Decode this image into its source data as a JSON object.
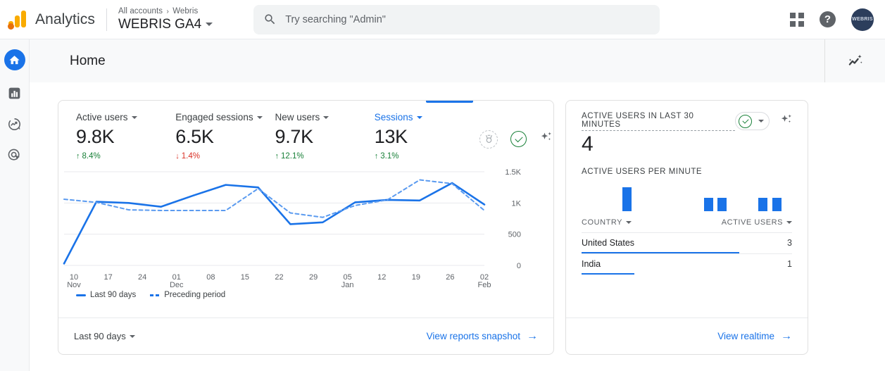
{
  "topbar": {
    "brand": "Analytics",
    "breadcrumb_all": "All accounts",
    "breadcrumb_sep": "›",
    "breadcrumb_account": "Webris",
    "property": "WEBRIS GA4",
    "search_placeholder": "Try searching \"Admin\"",
    "search_value": "",
    "help_glyph": "?",
    "avatar_text": "WEBRIS"
  },
  "sidebar": {
    "items": [
      {
        "name": "home",
        "label": "Home",
        "active": true
      },
      {
        "name": "reports",
        "label": "Reports",
        "active": false
      },
      {
        "name": "explore",
        "label": "Explore",
        "active": false
      },
      {
        "name": "advertising",
        "label": "Advertising",
        "active": false
      }
    ]
  },
  "page": {
    "title": "Home",
    "insights_icon": "insights-sparkle-icon"
  },
  "overview": {
    "metrics": [
      {
        "label": "Active users",
        "value": "9.8K",
        "delta": "8.4%",
        "direction": "up",
        "selected": false
      },
      {
        "label": "Engaged sessions",
        "value": "6.5K",
        "delta": "1.4%",
        "direction": "down",
        "selected": false
      },
      {
        "label": "New users",
        "value": "9.7K",
        "delta": "12.1%",
        "direction": "up",
        "selected": false
      },
      {
        "label": "Sessions",
        "value": "13K",
        "delta": "3.1%",
        "direction": "up",
        "selected": true
      }
    ],
    "arrow_up": "↑",
    "arrow_down": "↓",
    "legend": [
      {
        "label": "Last 90 days",
        "style": "solid"
      },
      {
        "label": "Preceding period",
        "style": "dashed"
      }
    ],
    "date_range": "Last 90 days",
    "footer_link": "View reports snapshot",
    "footer_arrow": "→",
    "accent_color": "#1a73e8",
    "up_color": "#188038",
    "down_color": "#d93025"
  },
  "chart_data": {
    "type": "line",
    "title": "Sessions",
    "xlabel": "",
    "ylabel": "",
    "ylim": [
      0,
      1500
    ],
    "yticks": [
      0,
      500,
      1000,
      1500
    ],
    "ytick_labels": [
      "0",
      "500",
      "1K",
      "1.5K"
    ],
    "grid": true,
    "legend_position": "bottom-left",
    "x": [
      "10 Nov",
      "17",
      "24",
      "01 Dec",
      "08",
      "15",
      "22",
      "29",
      "05 Jan",
      "12",
      "19",
      "26",
      "02 Feb"
    ],
    "xtick_labels": [
      {
        "day": "10",
        "month": "Nov"
      },
      {
        "day": "17",
        "month": ""
      },
      {
        "day": "24",
        "month": ""
      },
      {
        "day": "01",
        "month": "Dec"
      },
      {
        "day": "08",
        "month": ""
      },
      {
        "day": "15",
        "month": ""
      },
      {
        "day": "22",
        "month": ""
      },
      {
        "day": "29",
        "month": ""
      },
      {
        "day": "05",
        "month": "Jan"
      },
      {
        "day": "12",
        "month": ""
      },
      {
        "day": "19",
        "month": ""
      },
      {
        "day": "26",
        "month": ""
      },
      {
        "day": "02",
        "month": "Feb"
      }
    ],
    "series": [
      {
        "name": "Last 90 days",
        "style": "solid",
        "color": "#1a73e8",
        "values": [
          30,
          1020,
          1000,
          940,
          1120,
          1290,
          1250,
          660,
          690,
          1010,
          1050,
          1040,
          1320,
          975
        ]
      },
      {
        "name": "Preceding period",
        "style": "dashed",
        "color": "#5b9bf0",
        "values": [
          1060,
          1010,
          890,
          880,
          880,
          880,
          1230,
          840,
          770,
          960,
          1050,
          1370,
          1310,
          880
        ]
      }
    ]
  },
  "realtime": {
    "title": "ACTIVE USERS IN LAST 30 MINUTES",
    "value": "4",
    "per_minute_label": "ACTIVE USERS PER MINUTE",
    "per_minute_bars": [
      {
        "minute": 6,
        "height": 2
      },
      {
        "minute": 18,
        "height": 1
      },
      {
        "minute": 20,
        "height": 1
      },
      {
        "minute": 26,
        "height": 1
      },
      {
        "minute": 28,
        "height": 1
      }
    ],
    "table": {
      "columns": [
        "COUNTRY",
        "ACTIVE USERS"
      ],
      "rows": [
        {
          "country": "United States",
          "active_users": "3",
          "bar_pct": 75
        },
        {
          "country": "India",
          "active_users": "1",
          "bar_pct": 25
        }
      ]
    },
    "footer_link": "View realtime",
    "footer_arrow": "→"
  }
}
